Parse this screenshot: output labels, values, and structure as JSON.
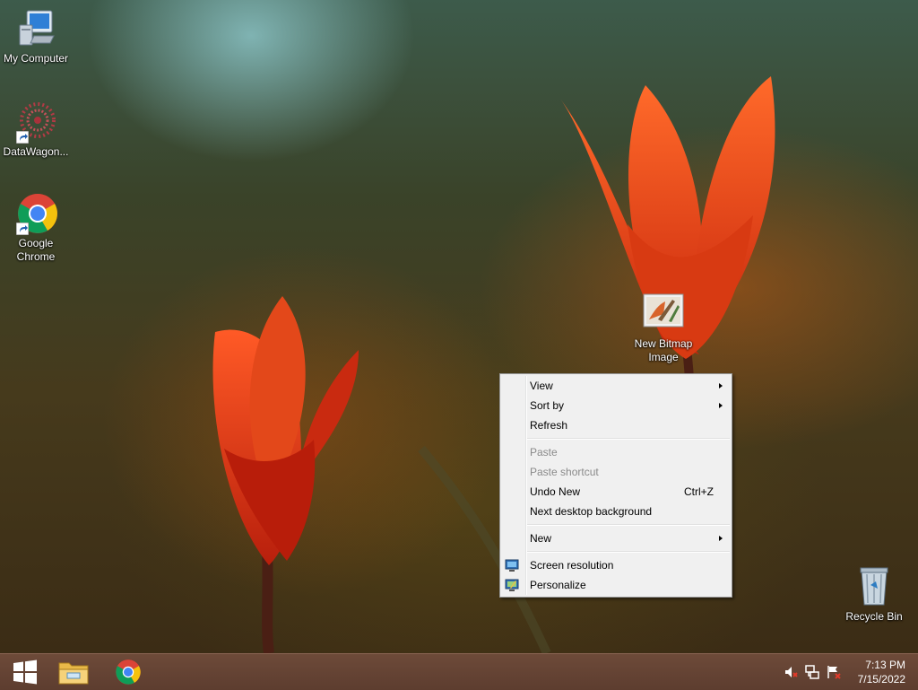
{
  "desktop": {
    "icons": [
      {
        "label": "My Computer",
        "icon": "computer-icon"
      },
      {
        "label": "DataWagon...",
        "icon": "datawagon-icon"
      },
      {
        "label": "Google Chrome",
        "icon": "chrome-icon"
      },
      {
        "label": "New Bitmap Image",
        "icon": "bitmap-image-icon"
      },
      {
        "label": "Recycle Bin",
        "icon": "recycle-bin-icon"
      }
    ]
  },
  "context_menu": {
    "items": [
      {
        "label": "View",
        "submenu": true
      },
      {
        "label": "Sort by",
        "submenu": true
      },
      {
        "label": "Refresh"
      },
      {
        "label": "Paste",
        "disabled": true
      },
      {
        "label": "Paste shortcut",
        "disabled": true
      },
      {
        "label": "Undo New",
        "shortcut": "Ctrl+Z"
      },
      {
        "label": "Next desktop background"
      },
      {
        "label": "New",
        "submenu": true
      },
      {
        "label": "Screen resolution",
        "icon": "screen-resolution-icon"
      },
      {
        "label": "Personalize",
        "icon": "personalize-icon"
      }
    ]
  },
  "taskbar": {
    "pinned": [
      {
        "name": "start-button",
        "icon": "windows-logo-icon"
      },
      {
        "name": "file-explorer",
        "icon": "folder-icon"
      },
      {
        "name": "google-chrome",
        "icon": "chrome-icon"
      }
    ],
    "tray": {
      "icons": [
        "volume-muted-icon",
        "network-icon",
        "action-center-flag-icon"
      ],
      "time": "7:13 PM",
      "date": "7/15/2022"
    }
  },
  "colors": {
    "taskbar": "#5d3d2f",
    "menu_background": "#f0f0f0",
    "disabled_text": "#8a8a8a"
  }
}
